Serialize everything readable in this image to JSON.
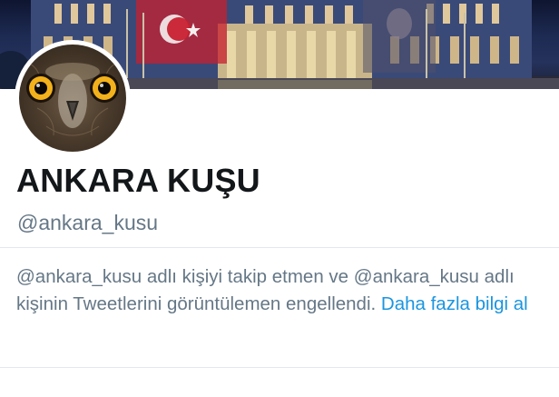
{
  "profile": {
    "display_name": "ANKARA KUŞU",
    "handle": "@ankara_kusu"
  },
  "blocked_notice": {
    "message": "@ankara_kusu adlı kişiyi takip etmen ve @ankara_kusu adlı kişinin Tweetlerini görüntülemen engellendi.",
    "learn_more_link": "Daha fazla bilgi al"
  },
  "colors": {
    "name_text": "#14171a",
    "secondary_text": "#657786",
    "link": "#1b95e0",
    "divider": "#e1e8ed"
  }
}
